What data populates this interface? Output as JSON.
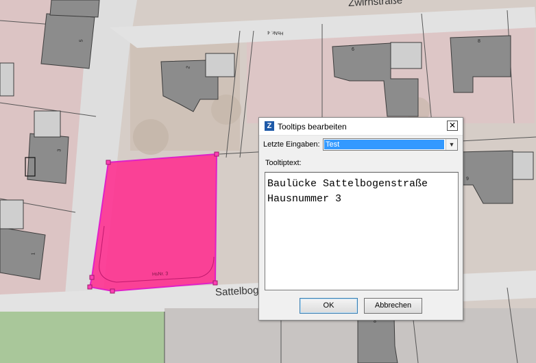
{
  "map": {
    "street_labels": [
      "Zwirnstraße",
      "Sattelbog"
    ],
    "house_numbers": [
      "5",
      "3",
      "1",
      "2",
      "6",
      "8",
      "9",
      "8"
    ],
    "polygon_label": "HsNr. 3",
    "rotated_label": "HsNr. 4",
    "polygon_color": "#ff2d8f"
  },
  "dialog": {
    "app_icon": "Z",
    "title": "Tooltips bearbeiten",
    "close_glyph": "✕",
    "recent_label": "Letzte Eingaben:",
    "recent_value": "Test",
    "tooltip_label": "Tooltiptext:",
    "tooltip_text": "Baulücke Sattelbogenstraße\nHausnummer 3",
    "ok_label": "OK",
    "cancel_label": "Abbrechen",
    "accent_color": "#3399ff"
  }
}
